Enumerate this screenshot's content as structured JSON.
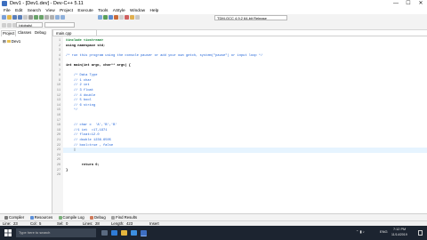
{
  "window": {
    "title": "Dev1 - [Dev1.dev] - Dev-C++ 5.11"
  },
  "window_controls": [
    "—",
    "☐",
    "✕"
  ],
  "menu": [
    "File",
    "Edit",
    "Search",
    "View",
    "Project",
    "Execute",
    "Tools",
    "AStyle",
    "Window",
    "Help"
  ],
  "toolbar": {
    "compiler_select": "TDM-GCC 4.9.2 64-bit Release",
    "scope_select": "(globals)",
    "member_select": ""
  },
  "left_panel": {
    "tabs": [
      "Project",
      "Classes",
      "Debug"
    ],
    "tree_root": "Dev1"
  },
  "editor": {
    "tab_label": "main.cpp",
    "line_numbers": [
      "1",
      "2",
      "3",
      "4",
      "5",
      "6",
      "7",
      "8",
      "9",
      "10",
      "11",
      "12",
      "13",
      "14",
      "15",
      "16",
      "17",
      "18",
      "19",
      "20",
      "21",
      "22",
      "23",
      "24",
      "25",
      "26",
      "27",
      "28"
    ],
    "lines": [
      {
        "t": "#include <iostream>",
        "c": "#0a7a2a",
        "b": true
      },
      {
        "t": "using namespace std;",
        "c": "#000000",
        "b": true
      },
      {
        "t": "",
        "c": "#000000",
        "b": false
      },
      {
        "t": "/* run this program using the console pauser or add your own getch, system(\"pause\") or input loop */",
        "c": "#1a5fd6",
        "b": false
      },
      {
        "t": "",
        "c": "#000000",
        "b": false
      },
      {
        "t": "int main(int argc, char** argv) {",
        "c": "#000000",
        "b": true
      },
      {
        "t": "",
        "c": "#000000",
        "b": false
      },
      {
        "t": "    /* Data Type",
        "c": "#1a5fd6",
        "b": false
      },
      {
        "t": "    // 1 char",
        "c": "#1a5fd6",
        "b": false
      },
      {
        "t": "    // 2 int",
        "c": "#1a5fd6",
        "b": false
      },
      {
        "t": "    // 3 float",
        "c": "#1a5fd6",
        "b": false
      },
      {
        "t": "    // 4 double",
        "c": "#1a5fd6",
        "b": false
      },
      {
        "t": "    // 5 bool",
        "c": "#1a5fd6",
        "b": false
      },
      {
        "t": "    // 6 string",
        "c": "#1a5fd6",
        "b": false
      },
      {
        "t": "    */",
        "c": "#1a5fd6",
        "b": false
      },
      {
        "t": "",
        "c": "#000000",
        "b": false
      },
      {
        "t": "",
        "c": "#000000",
        "b": false
      },
      {
        "t": "    // char c  'A','B','B'",
        "c": "#1a5fd6",
        "b": false
      },
      {
        "t": "    //1 int  =17,1971",
        "c": "#1a5fd6",
        "b": false
      },
      {
        "t": "    // float=12.0",
        "c": "#1a5fd6",
        "b": false
      },
      {
        "t": "    // double 1236.6505",
        "c": "#1a5fd6",
        "b": false
      },
      {
        "t": "    // bool=true , false",
        "c": "#1a5fd6",
        "b": false
      },
      {
        "t": "    |",
        "c": "#000000",
        "b": false
      },
      {
        "t": "",
        "c": "#000000",
        "b": false
      },
      {
        "t": "",
        "c": "#000000",
        "b": false
      },
      {
        "t": "        return 0;",
        "c": "#000000",
        "b": true
      },
      {
        "t": "}",
        "c": "#000000",
        "b": true
      },
      {
        "t": "",
        "c": "#000000",
        "b": false
      }
    ],
    "current_line": 23
  },
  "bottom_tabs": [
    "Compiler",
    "Resources",
    "Compile Log",
    "Debug",
    "Find Results"
  ],
  "status_bar": {
    "line_label": "Line:",
    "line_value": "23",
    "col_label": "Col:",
    "col_value": "5",
    "sel_label": "Sel:",
    "sel_value": "0",
    "lines_label": "Lines:",
    "lines_value": "28",
    "length_label": "Length:",
    "length_value": "423",
    "mode": "Insert"
  },
  "taskbar": {
    "search_placeholder": "Type here to search",
    "lang": "ENG",
    "time": "7:12 PM",
    "date": "11/14/2019"
  }
}
